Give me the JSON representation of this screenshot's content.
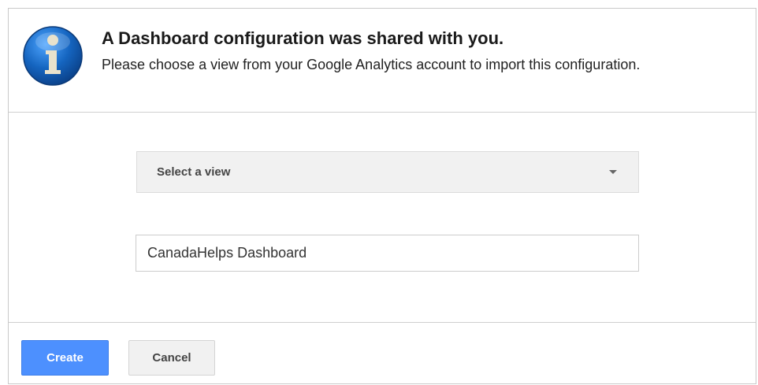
{
  "dialog": {
    "icon": "info-icon",
    "title": "A Dashboard configuration was shared with you.",
    "message": "Please choose a view from your Google Analytics account to import this configuration."
  },
  "form": {
    "view_select": {
      "label": "Select a view",
      "icon": "dropdown-arrow-icon"
    },
    "dashboard_name": {
      "value": "CanadaHelps Dashboard"
    }
  },
  "buttons": {
    "create_label": "Create",
    "cancel_label": "Cancel"
  },
  "colors": {
    "primary_button": "#4d90fe",
    "info_icon": "#1565c0"
  }
}
